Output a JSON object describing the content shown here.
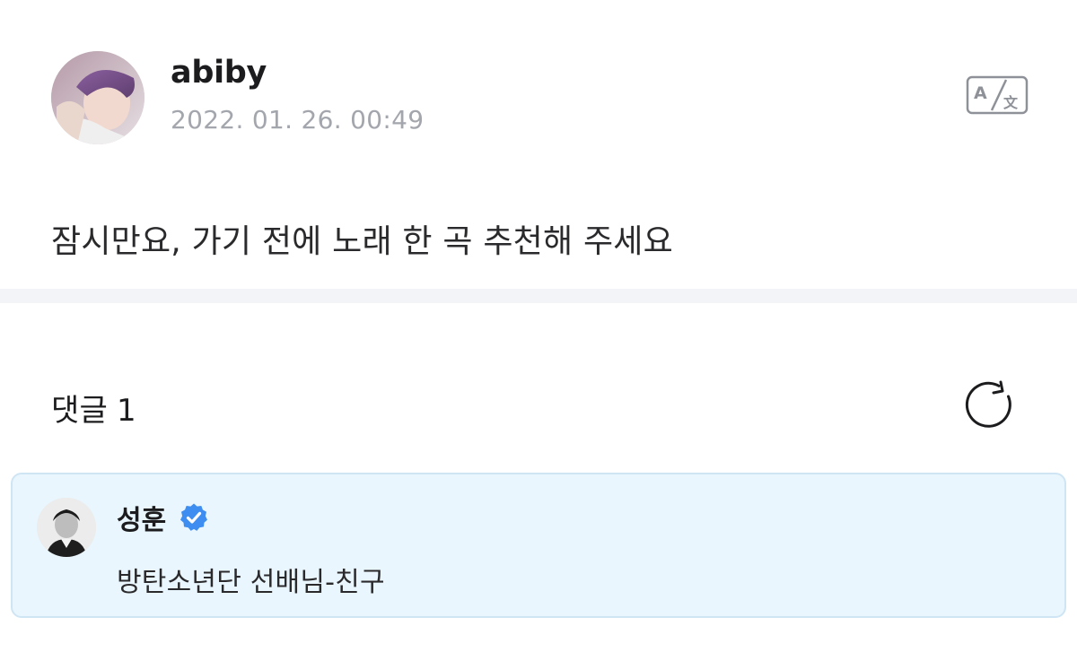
{
  "post": {
    "author": "abiby",
    "timestamp": "2022. 01. 26. 00:49",
    "body": "잠시만요, 가기 전에 노래 한 곡 추천해 주세요",
    "translate_icon": "translate-icon"
  },
  "comments": {
    "title": "댓글",
    "count": "1",
    "refresh_icon": "refresh-icon",
    "items": [
      {
        "author": "성훈",
        "verified": true,
        "text": "방탄소년단 선배님-친구"
      }
    ]
  },
  "colors": {
    "muted_text": "#a3a6ad",
    "comment_bg": "#e9f6fd",
    "comment_border": "#cfe5f4",
    "verified_blue": "#3d8ef0",
    "divider": "#f3f4f7"
  }
}
